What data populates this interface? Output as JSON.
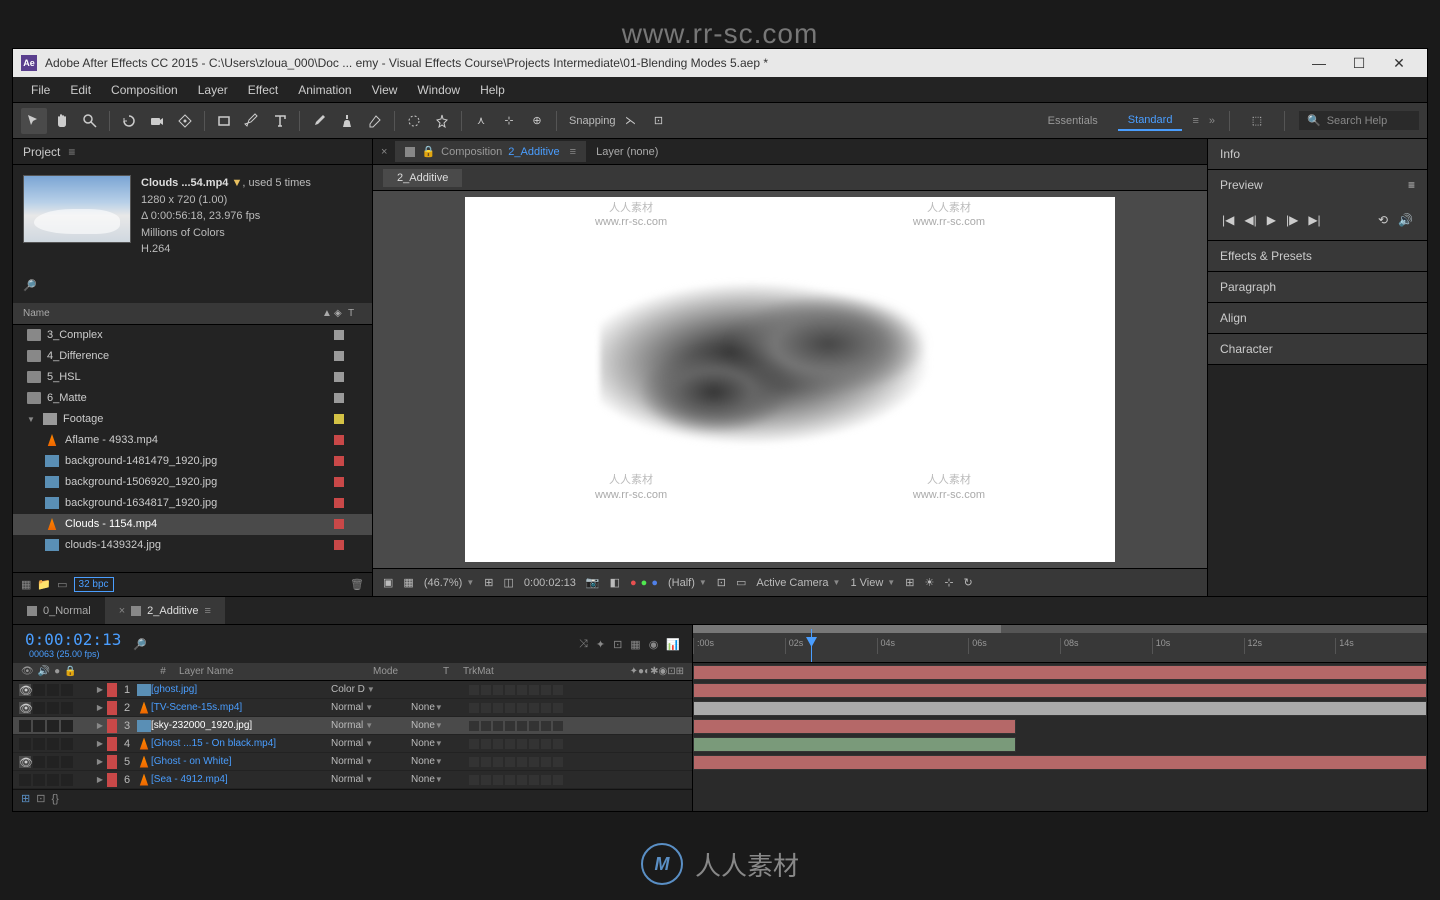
{
  "watermark_url": "www.rr-sc.com",
  "watermark_cn": "人人素材",
  "titlebar": {
    "app_logo": "Ae",
    "title": "Adobe After Effects CC 2015 - C:\\Users\\zloua_000\\Doc ... emy - Visual Effects Course\\Projects Intermediate\\01-Blending Modes 5.aep *"
  },
  "menu": [
    "File",
    "Edit",
    "Composition",
    "Layer",
    "Effect",
    "Animation",
    "View",
    "Window",
    "Help"
  ],
  "toolbar": {
    "snapping": "Snapping",
    "workspaces": {
      "essentials": "Essentials",
      "standard": "Standard"
    },
    "search_placeholder": "Search Help"
  },
  "project": {
    "panel_title": "Project",
    "asset": {
      "name": "Clouds ...54.mp4",
      "used": ", used 5 times",
      "dims": "1280 x 720 (1.00)",
      "duration": "Δ 0:00:56:18, 23.976 fps",
      "colors": "Millions of Colors",
      "codec": "H.264"
    },
    "name_col": "Name",
    "items": [
      {
        "type": "comp",
        "label": "3_Complex",
        "color": "#9a9a9a",
        "indent": 0
      },
      {
        "type": "comp",
        "label": "4_Difference",
        "color": "#9a9a9a",
        "indent": 0
      },
      {
        "type": "comp",
        "label": "5_HSL",
        "color": "#9a9a9a",
        "indent": 0
      },
      {
        "type": "comp",
        "label": "6_Matte",
        "color": "#9a9a9a",
        "indent": 0
      },
      {
        "type": "folder",
        "label": "Footage",
        "color": "#d4c245",
        "indent": 0,
        "expanded": true
      },
      {
        "type": "video",
        "label": "Aflame - 4933.mp4",
        "color": "#c94848",
        "indent": 1
      },
      {
        "type": "image",
        "label": "background-1481479_1920.jpg",
        "color": "#c94848",
        "indent": 1
      },
      {
        "type": "image",
        "label": "background-1506920_1920.jpg",
        "color": "#c94848",
        "indent": 1
      },
      {
        "type": "image",
        "label": "background-1634817_1920.jpg",
        "color": "#c94848",
        "indent": 1
      },
      {
        "type": "video",
        "label": "Clouds - 1154.mp4",
        "color": "#c94848",
        "indent": 1,
        "selected": true
      },
      {
        "type": "image",
        "label": "clouds-1439324.jpg",
        "color": "#c94848",
        "indent": 1
      }
    ],
    "bpc": "32 bpc"
  },
  "composition": {
    "label": "Composition",
    "name": "2_Additive",
    "layer_none": "Layer (none)",
    "active_tab": "2_Additive"
  },
  "viewer_footer": {
    "zoom": "(46.7%)",
    "time": "0:00:02:13",
    "quality": "(Half)",
    "camera": "Active Camera",
    "views": "1 View"
  },
  "right_panel": {
    "info": "Info",
    "preview": "Preview",
    "effects": "Effects & Presets",
    "paragraph": "Paragraph",
    "align": "Align",
    "character": "Character"
  },
  "timeline": {
    "tabs": [
      {
        "label": "0_Normal",
        "active": false
      },
      {
        "label": "2_Additive",
        "active": true
      }
    ],
    "timecode": "0:00:02:13",
    "frame_info": "00063 (25.00 fps)",
    "cols": {
      "num": "#",
      "name": "Layer Name",
      "mode": "Mode",
      "t": "T",
      "trkmat": "TrkMat"
    },
    "layers": [
      {
        "num": "1",
        "name": "[ghost.jpg]",
        "mode": "Color D",
        "trk": "",
        "color": "#c94848",
        "icon": "image",
        "bar_color": "#b56868",
        "bar_start": 0,
        "bar_end": 100
      },
      {
        "num": "2",
        "name": "[TV-Scene-15s.mp4]",
        "mode": "Normal",
        "trk": "None",
        "color": "#c94848",
        "icon": "video",
        "bar_color": "#b56868",
        "bar_start": 0,
        "bar_end": 100
      },
      {
        "num": "3",
        "name": "[sky-232000_1920.jpg]",
        "mode": "Normal",
        "trk": "None",
        "color": "#c94848",
        "icon": "image",
        "selected": true,
        "bar_color": "#888",
        "bar_start": 0,
        "bar_end": 100
      },
      {
        "num": "4",
        "name": "[Ghost ...15 - On black.mp4]",
        "mode": "Normal",
        "trk": "None",
        "color": "#c94848",
        "icon": "video",
        "bar_color": "#b56868",
        "bar_start": 0,
        "bar_end": 44
      },
      {
        "num": "5",
        "name": "[Ghost - on White]",
        "mode": "Normal",
        "trk": "None",
        "color": "#c94848",
        "icon": "video",
        "bar_color": "#7a9a7a",
        "bar_start": 0,
        "bar_end": 44
      },
      {
        "num": "6",
        "name": "[Sea - 4912.mp4]",
        "mode": "Normal",
        "trk": "None",
        "color": "#c94848",
        "icon": "video",
        "bar_color": "#b56868",
        "bar_start": 0,
        "bar_end": 100
      }
    ],
    "ruler": [
      ":00s",
      "02s",
      "04s",
      "06s",
      "08s",
      "10s",
      "12s",
      "14s"
    ]
  },
  "bottom_logo_text": "M"
}
